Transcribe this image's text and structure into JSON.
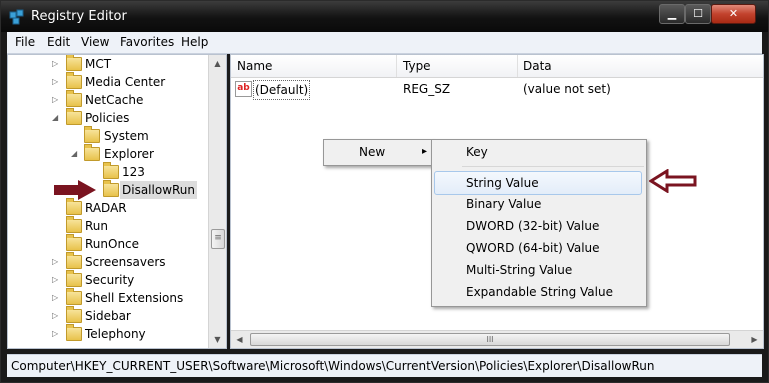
{
  "window": {
    "title": "Registry Editor",
    "min_label": "▁",
    "max_label": "☐",
    "close_label": "✕"
  },
  "menubar": [
    "File",
    "Edit",
    "View",
    "Favorites",
    "Help"
  ],
  "tree": {
    "items": [
      {
        "label": "MCT"
      },
      {
        "label": "Media Center"
      },
      {
        "label": "NetCache"
      },
      {
        "label": "Policies"
      },
      {
        "label": "System"
      },
      {
        "label": "Explorer"
      },
      {
        "label": "123"
      },
      {
        "label": "DisallowRun"
      },
      {
        "label": "RADAR"
      },
      {
        "label": "Run"
      },
      {
        "label": "RunOnce"
      },
      {
        "label": "Screensavers"
      },
      {
        "label": "Security"
      },
      {
        "label": "Shell Extensions"
      },
      {
        "label": "Sidebar"
      },
      {
        "label": "Telephony"
      }
    ],
    "expand_collapsed": "▷",
    "expand_open": "◢"
  },
  "list": {
    "columns": [
      "Name",
      "Type",
      "Data"
    ],
    "rows": [
      {
        "name": "(Default)",
        "type": "REG_SZ",
        "data": "(value not set)"
      }
    ],
    "value_icon_text": "ab"
  },
  "context_menu": {
    "new_label": "New",
    "submenu_arrow": "▸"
  },
  "submenu": {
    "items": [
      "Key",
      "String Value",
      "Binary Value",
      "DWORD (32-bit) Value",
      "QWORD (64-bit) Value",
      "Multi-String Value",
      "Expandable String Value"
    ],
    "highlighted": "String Value"
  },
  "status_bar": {
    "path": "Computer\\HKEY_CURRENT_USER\\Software\\Microsoft\\Windows\\CurrentVersion\\Policies\\Explorer\\DisallowRun"
  },
  "scroll": {
    "up": "▲",
    "down": "▼",
    "left": "◀",
    "right": "▶",
    "grip": "≡",
    "hgrip": "III"
  },
  "colors": {
    "annotation_arrow": "#7a1420",
    "selection": "#dcdcdc",
    "title_bar": "#121212"
  }
}
